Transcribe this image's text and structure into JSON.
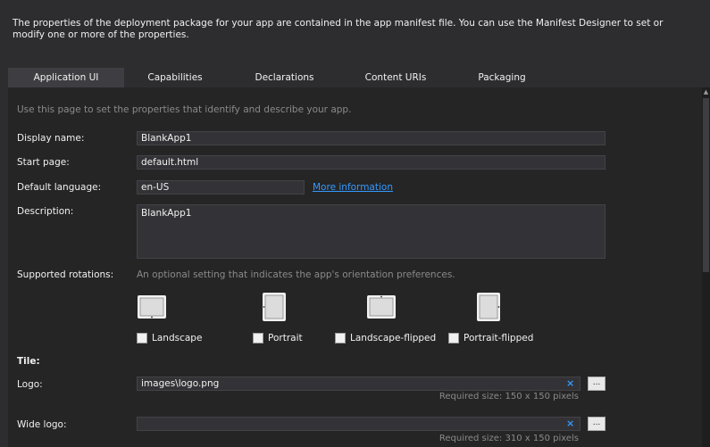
{
  "description_text": "The properties of the deployment package for your app are contained in the app manifest file. You can use the Manifest Designer to set or modify one or more of the properties.",
  "tabs": [
    {
      "label": "Application UI",
      "active": true
    },
    {
      "label": "Capabilities",
      "active": false
    },
    {
      "label": "Declarations",
      "active": false
    },
    {
      "label": "Content URIs",
      "active": false
    },
    {
      "label": "Packaging",
      "active": false
    }
  ],
  "intro": "Use this page to set the properties that identify and describe your app.",
  "display_name": {
    "label": "Display name:",
    "value": "BlankApp1"
  },
  "start_page": {
    "label": "Start page:",
    "value": "default.html"
  },
  "default_language": {
    "label": "Default language:",
    "value": "en-US",
    "link": "More information"
  },
  "description": {
    "label": "Description:",
    "value": "BlankApp1"
  },
  "rotations": {
    "label": "Supported rotations:",
    "hint": "An optional setting that indicates the app's orientation preferences.",
    "options": [
      {
        "label": "Landscape",
        "checked": false,
        "icon": "landscape-icon"
      },
      {
        "label": "Portrait",
        "checked": false,
        "icon": "portrait-icon"
      },
      {
        "label": "Landscape-flipped",
        "checked": false,
        "icon": "landscape-flipped-icon"
      },
      {
        "label": "Portrait-flipped",
        "checked": false,
        "icon": "portrait-flipped-icon"
      }
    ]
  },
  "tile": {
    "label": "Tile:",
    "logo": {
      "label": "Logo:",
      "value": "images\\logo.png",
      "required": "Required size: 150 x 150 pixels",
      "clear": "×",
      "browse": "..."
    },
    "wide_logo": {
      "label": "Wide logo:",
      "value": "",
      "required": "Required size: 310 x 150 pixels",
      "clear": "×",
      "browse": "..."
    }
  },
  "scroll_arrow": "▲"
}
